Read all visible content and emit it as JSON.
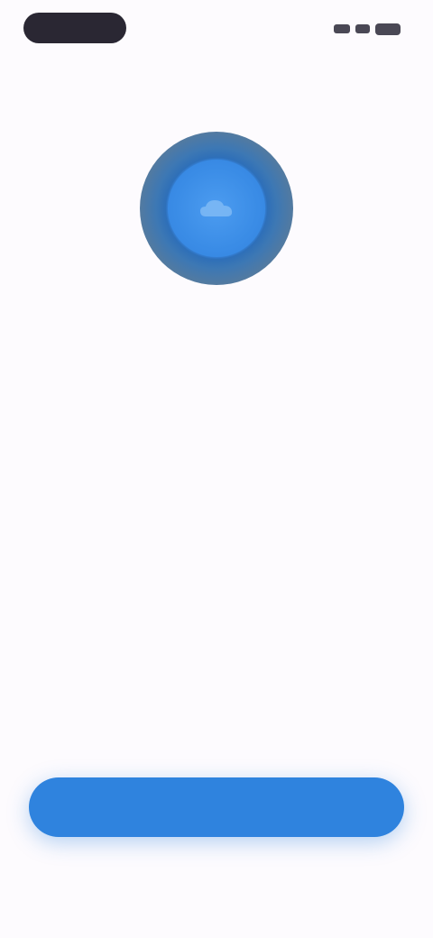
{
  "status_bar": {
    "time": ""
  },
  "hero": {
    "icon": "cloud-icon",
    "colors": {
      "ring": "#2e6fb8",
      "fill": "#3a8ce6"
    }
  },
  "content": {
    "eyebrow": "",
    "headline_strong": "",
    "headline_rest": "",
    "description": ""
  },
  "actions": {
    "continue_label": "",
    "accent": "#2f83de"
  }
}
